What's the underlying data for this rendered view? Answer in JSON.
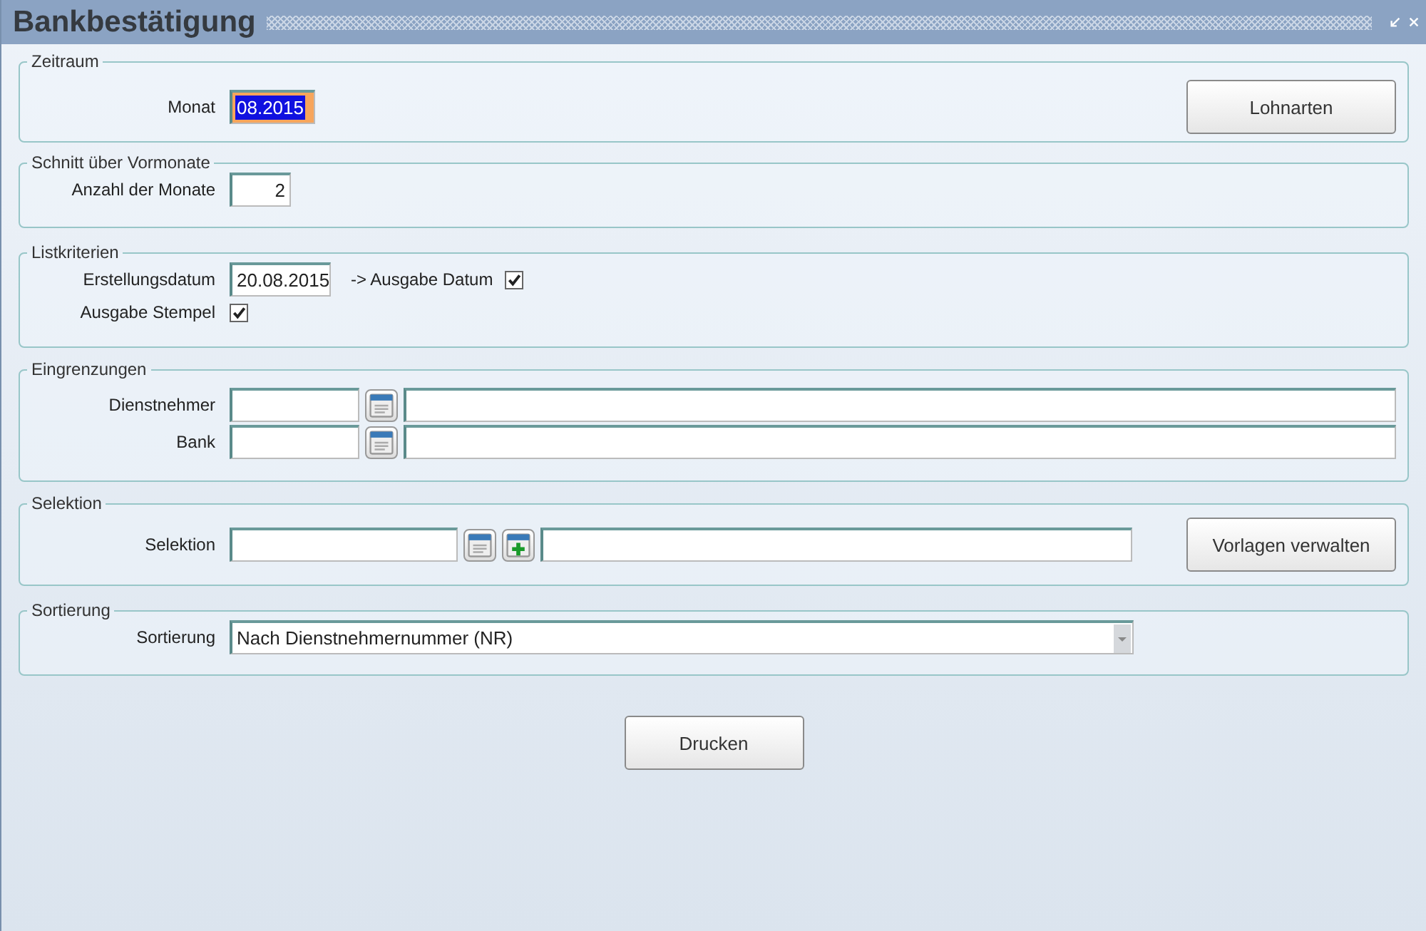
{
  "window": {
    "title": "Bankbestätigung"
  },
  "zeitraum": {
    "legend": "Zeitraum",
    "label": "Monat",
    "value": "08.2015",
    "selected": true,
    "button": "Lohnarten"
  },
  "schnitt": {
    "legend": "Schnitt über Vormonate",
    "label": "Anzahl der Monate",
    "value": "2"
  },
  "listkriterien": {
    "legend": "Listkriterien",
    "date_label": "Erstellungsdatum",
    "date_value": "20.08.2015",
    "date_check_label": "-> Ausgabe Datum",
    "date_check": true,
    "stamp_label": "Ausgabe Stempel",
    "stamp_check": true
  },
  "eingrenzungen": {
    "legend": "Eingrenzungen",
    "rows": [
      {
        "label": "Dienstnehmer"
      },
      {
        "label": "Bank"
      }
    ]
  },
  "selektion": {
    "legend": "Selektion",
    "label": "Selektion",
    "button": "Vorlagen verwalten"
  },
  "sortierung": {
    "legend": "Sortierung",
    "label": "Sortierung",
    "value": "Nach Dienstnehmernummer (NR)"
  },
  "print_button": "Drucken"
}
